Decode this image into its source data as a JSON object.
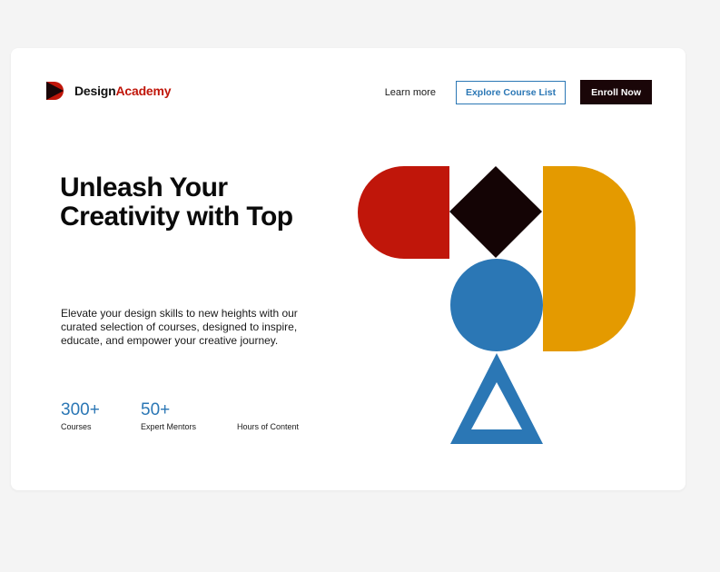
{
  "brand": {
    "name_part1": "Design",
    "name_part2": "Academy",
    "logo_icon": "d-logo-icon"
  },
  "nav": {
    "learn_more": "Learn more",
    "explore": "Explore Course List",
    "enroll": "Enroll Now"
  },
  "hero": {
    "title": "Unleash Your Creativity with Top",
    "description": "Elevate your design skills to new heights with our curated selection of courses, designed to inspire, educate, and empower your creative journey."
  },
  "stats": [
    {
      "value": "300+",
      "label": "Courses"
    },
    {
      "value": "50+",
      "label": "Expert Mentors"
    },
    {
      "value": "",
      "label": "Hours of Content"
    }
  ],
  "colors": {
    "accent_red": "#c0160a",
    "accent_blue": "#2b77b5",
    "accent_yellow": "#e49a00",
    "dark": "#1a0608",
    "background": "#f4f4f4"
  },
  "illustration": {
    "shapes": [
      "red-half-capsule",
      "black-diamond",
      "yellow-d-shape",
      "blue-circle",
      "blue-triangle-outline"
    ]
  }
}
